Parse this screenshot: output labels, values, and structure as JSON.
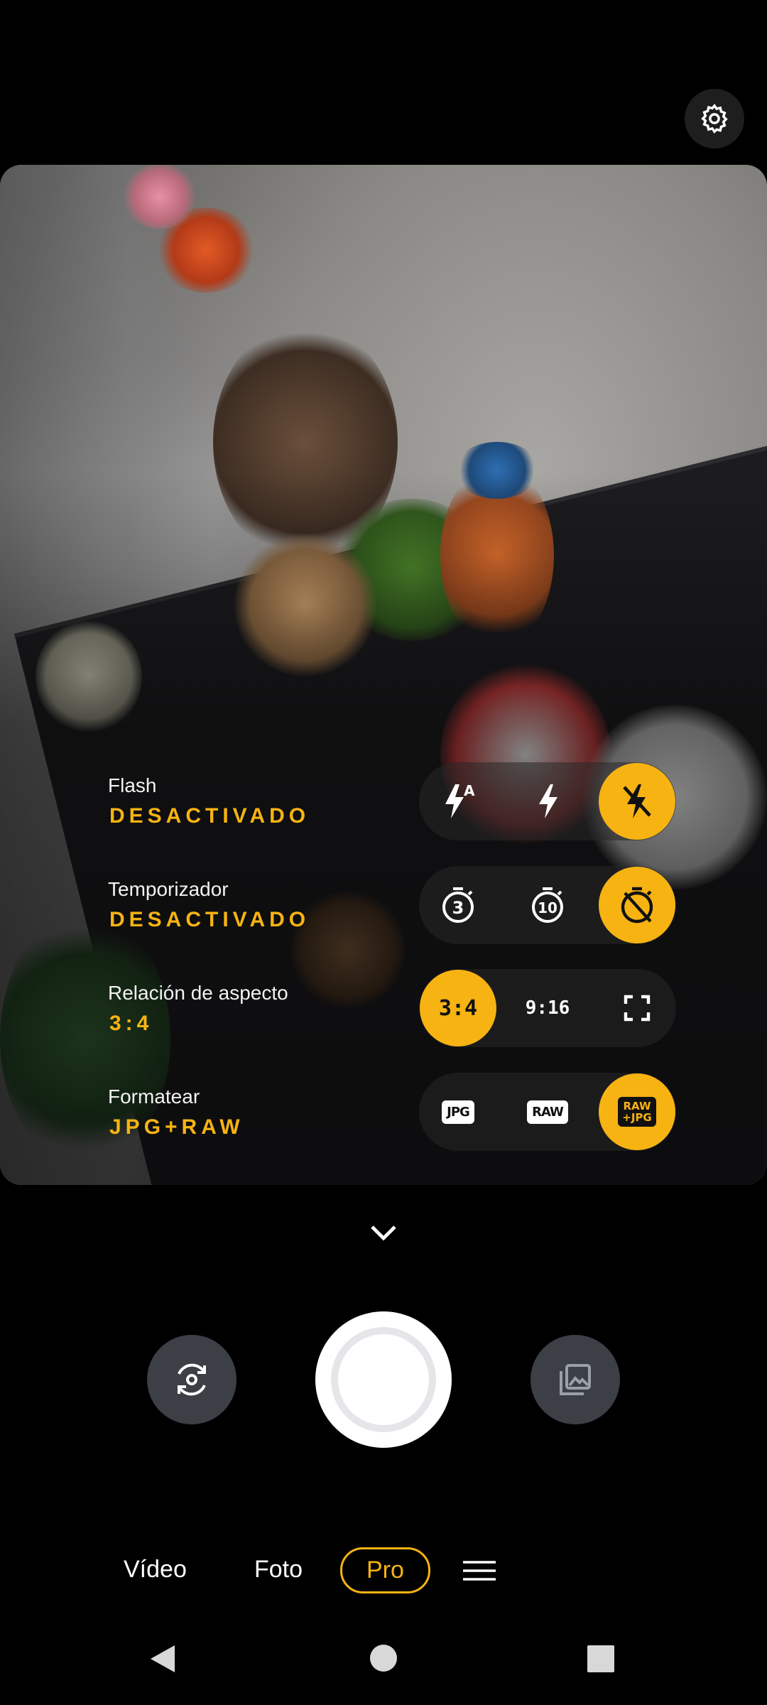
{
  "settings": {
    "icon": "gear-icon"
  },
  "quick_settings": [
    {
      "label": "Flash",
      "value": "DESACTIVADO"
    },
    {
      "label": "Temporizador",
      "value": "DESACTIVADO"
    },
    {
      "label": "Relación de aspecto",
      "value": "3:4"
    },
    {
      "label": "Formatear",
      "value": "JPG+RAW"
    }
  ],
  "flash_options": [
    "flash-auto-icon",
    "flash-on-icon",
    "flash-off-icon"
  ],
  "timer_options": {
    "t3": "3",
    "t10": "10",
    "off": "timer-off-icon"
  },
  "aspect_options": [
    "3:4",
    "9:16",
    "full-screen-icon"
  ],
  "format_options": {
    "jpg": "JPG",
    "raw": "RAW",
    "raw_jpg_top": "RAW",
    "raw_jpg_bottom": "+JPG"
  },
  "modes": [
    "Vídeo",
    "Foto",
    "Pro"
  ],
  "active_mode": "Pro",
  "accent_color": "#f6b312"
}
